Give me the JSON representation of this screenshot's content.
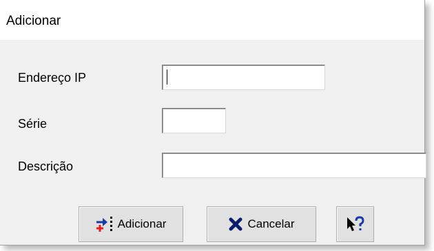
{
  "window": {
    "title": "Adicionar"
  },
  "form": {
    "ip_label": "Endereço IP",
    "ip_value": "",
    "serie_label": "Série",
    "serie_value": "",
    "descricao_label": "Descrição",
    "descricao_value": ""
  },
  "buttons": {
    "add_label": "Adicionar",
    "add_icon": "add-items-icon",
    "cancel_label": "Cancelar",
    "cancel_icon": "x-cancel-icon",
    "help_icon": "whats-this-help-icon"
  },
  "colors": {
    "dialog_bg": "#f0f0f0",
    "cancel_x": "#0d1f6b",
    "add_arrow": "#1a3aa8",
    "add_plus": "#e02020"
  }
}
